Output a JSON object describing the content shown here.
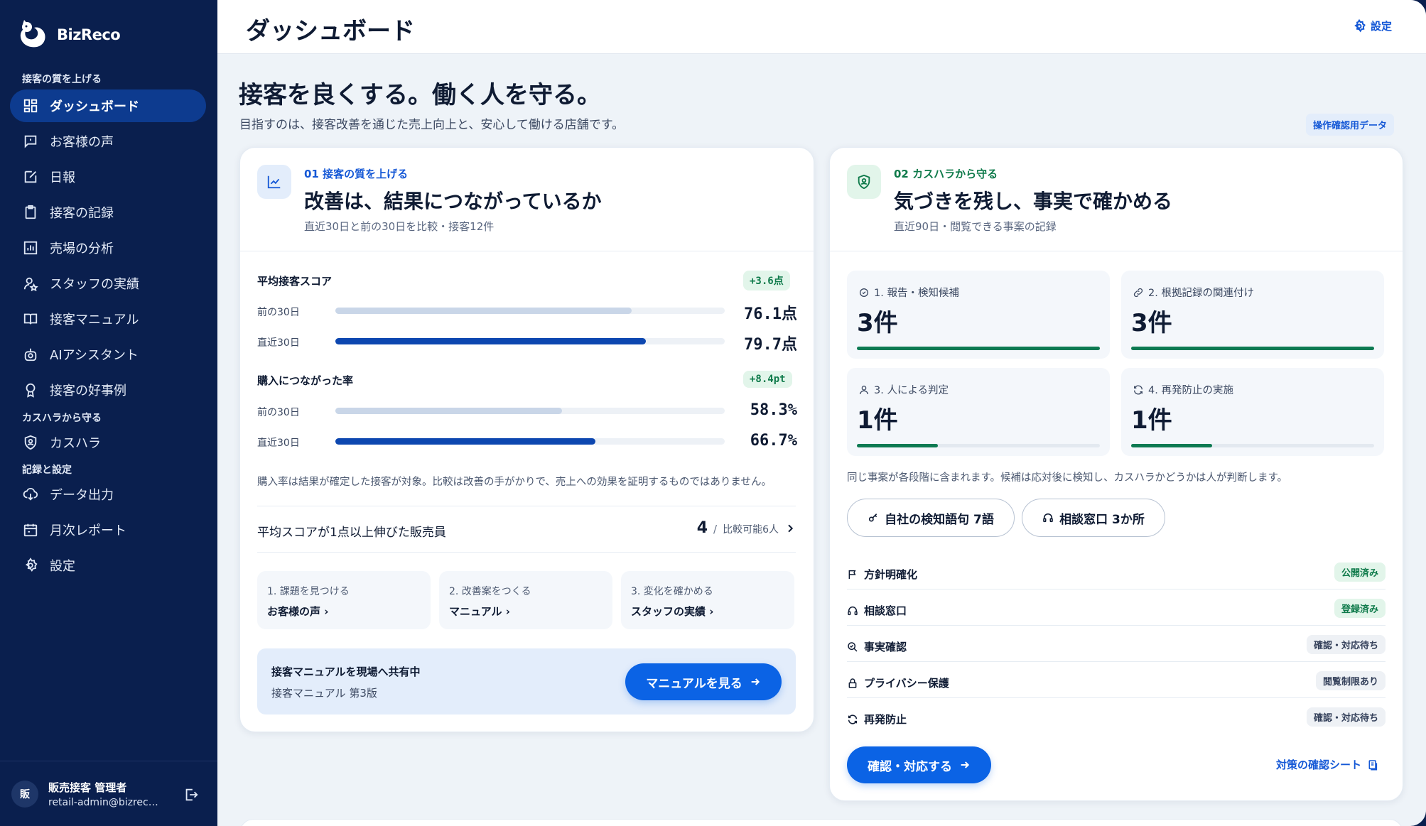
{
  "brand": {
    "name": "BizReco"
  },
  "sidebar": {
    "sections": [
      "接客の質を上げる",
      "カスハラから守る",
      "記録と設定"
    ],
    "items": [
      {
        "label": "ダッシュボード",
        "icon": "grid-icon"
      },
      {
        "label": "お客様の声",
        "icon": "message-icon"
      },
      {
        "label": "日報",
        "icon": "edit-icon"
      },
      {
        "label": "接客の記録",
        "icon": "clipboard-icon"
      },
      {
        "label": "売場の分析",
        "icon": "bar-chart-icon"
      },
      {
        "label": "スタッフの実績",
        "icon": "user-star-icon"
      },
      {
        "label": "接客マニュアル",
        "icon": "book-icon"
      },
      {
        "label": "AIアシスタント",
        "icon": "robot-icon"
      },
      {
        "label": "接客の好事例",
        "icon": "award-icon"
      },
      {
        "label": "カスハラ",
        "icon": "shield-user-icon"
      },
      {
        "label": "データ出力",
        "icon": "cloud-download-icon"
      },
      {
        "label": "月次レポート",
        "icon": "calendar-icon"
      },
      {
        "label": "設定",
        "icon": "gear-icon"
      }
    ],
    "user": {
      "initial": "販",
      "name": "販売接客 管理者",
      "email": "retail-admin@bizrec…"
    }
  },
  "header": {
    "title": "ダッシュボード",
    "settings_label": "設定"
  },
  "hero": {
    "title": "接客を良くする。働く人を守る。",
    "subtitle": "目指すのは、接客改善を通じた売上向上と、安心して働ける店舗です。",
    "badge": "操作確認用データ"
  },
  "quality": {
    "kicker": "01 接客の質を上げる",
    "title": "改善は、結果につながっているか",
    "subtitle": "直近30日と前の30日を比較・接客12件",
    "metrics": [
      {
        "label": "平均接客スコア",
        "delta": "+3.6点",
        "rows": [
          {
            "label": "前の30日",
            "value": "76.1点",
            "level": 0.761
          },
          {
            "label": "直近30日",
            "value": "79.7点",
            "level": 0.797
          }
        ]
      },
      {
        "label": "購入につながった率",
        "delta": "+8.4pt",
        "rows": [
          {
            "label": "前の30日",
            "value": "58.3%",
            "level": 0.583
          },
          {
            "label": "直近30日",
            "value": "66.7%",
            "level": 0.667
          }
        ]
      }
    ],
    "note": "購入率は結果が確定した接客が対象。比較は改善の手がかりで、売上への効果を証明するものではありません。",
    "improved": {
      "label": "平均スコアが1点以上伸びた販売員",
      "count": "4",
      "slash": "/",
      "comparable": "比較可能6人"
    },
    "steps": [
      {
        "label": "1. 課題を見つける",
        "link": "お客様の声 ›"
      },
      {
        "label": "2. 改善案をつくる",
        "link": "マニュアル ›"
      },
      {
        "label": "3. 変化を確かめる",
        "link": "スタッフの実績 ›"
      }
    ],
    "share": {
      "title": "接客マニュアルを現場へ共有中",
      "subtitle": "接客マニュアル 第3版",
      "button": "マニュアルを見る"
    }
  },
  "harassment": {
    "kicker": "02 カスハラから守る",
    "title": "気づきを残し、事実で確かめる",
    "subtitle": "直近90日・閲覧できる事案の記録",
    "stats": [
      {
        "label": "1. 報告・検知候補",
        "value": "3件",
        "level": 1.0
      },
      {
        "label": "2. 根拠記録の関連付け",
        "value": "3件",
        "level": 1.0
      },
      {
        "label": "3. 人による判定",
        "value": "1件",
        "level": 0.333
      },
      {
        "label": "4. 再発防止の実施",
        "value": "1件",
        "level": 0.333
      }
    ],
    "note": "同じ事案が各段階に含まれます。候補は応対後に検知し、カスハラかどうかは人が判断します。",
    "pills": [
      {
        "label": "自社の検知語句 7語"
      },
      {
        "label": "相談窓口 3か所"
      }
    ],
    "checks": [
      {
        "label": "方針明確化",
        "status": "公開済み",
        "tone": "green"
      },
      {
        "label": "相談窓口",
        "status": "登録済み",
        "tone": "green"
      },
      {
        "label": "事実確認",
        "status": "確認・対応待ち",
        "tone": "gray"
      },
      {
        "label": "プライバシー保護",
        "status": "閲覧制限あり",
        "tone": "gray"
      },
      {
        "label": "再発防止",
        "status": "確認・対応待ち",
        "tone": "gray"
      }
    ],
    "button": "確認・対応する",
    "sheet_link": "対策の確認シート"
  },
  "colors": {
    "navy": "#0a1f4e",
    "active": "#0d3b8f",
    "accent": "#0b63e5",
    "green": "#0d7a52",
    "prev_bar": "#c9d6e8",
    "cur_bar": "#0d47b0"
  }
}
